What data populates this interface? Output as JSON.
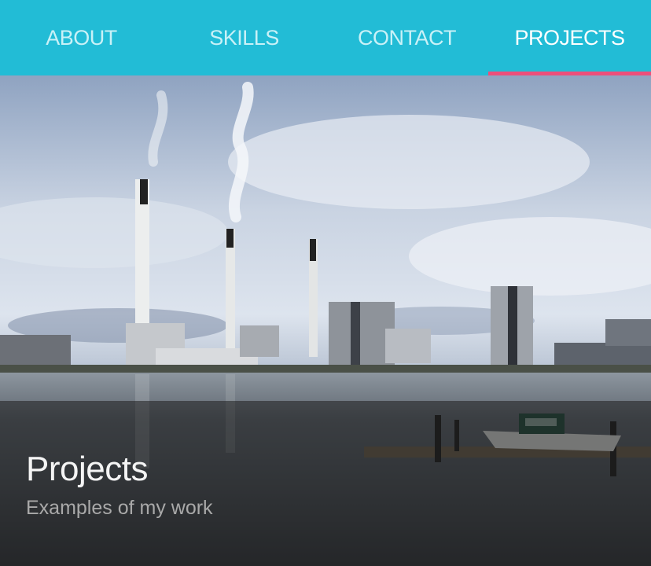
{
  "nav": {
    "tabs": [
      {
        "label": "ABOUT",
        "active": false
      },
      {
        "label": "SKILLS",
        "active": false
      },
      {
        "label": "CONTACT",
        "active": false
      },
      {
        "label": "PROJECTS",
        "active": true
      }
    ],
    "colors": {
      "bar": "#22bcd6",
      "active_underline": "#ec4f7b"
    }
  },
  "hero": {
    "title": "Projects",
    "subtitle": "Examples of my work"
  }
}
